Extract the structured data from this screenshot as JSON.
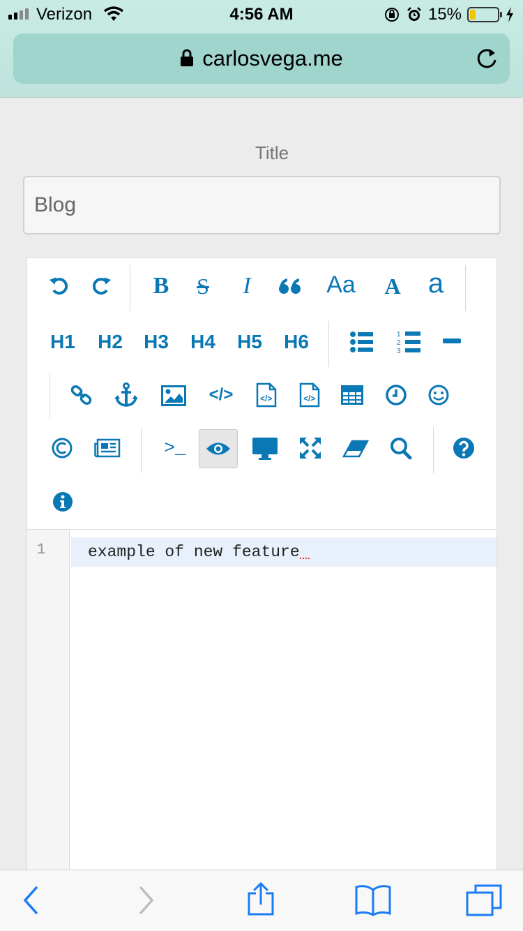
{
  "status_bar": {
    "carrier": "Verizon",
    "time": "4:56 AM",
    "battery": "15%",
    "battery_level": 0.15
  },
  "browser": {
    "url": "carlosvega.me"
  },
  "form": {
    "title_label": "Title",
    "title_value": "Blog"
  },
  "toolbar": {
    "h1": "H1",
    "h2": "H2",
    "h3": "H3",
    "h4": "H4",
    "h5": "H5",
    "h6": "H6",
    "font_case": "Aa",
    "upper_a": "A",
    "lower_a": "a",
    "terminal": ">_",
    "active_tool": "preview"
  },
  "editor": {
    "line_number": "1",
    "content": "example of new feature"
  },
  "colors": {
    "accent": "#0a78b5",
    "url_bar": "#9fd5cc"
  }
}
